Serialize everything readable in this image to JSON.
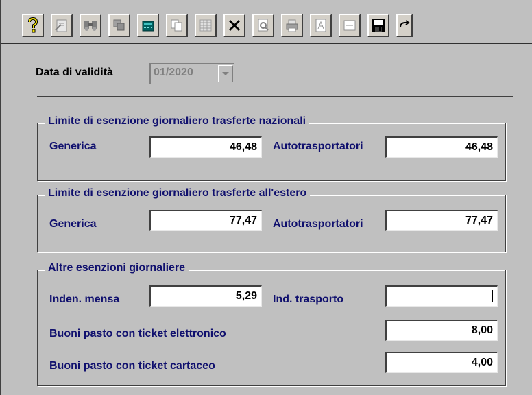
{
  "toolbar": {
    "buttons": [
      {
        "name": "help",
        "icon": "question-mark-icon"
      },
      {
        "name": "properties",
        "icon": "properties-icon"
      },
      {
        "name": "find",
        "icon": "binoculars-icon"
      },
      {
        "name": "copy-record",
        "icon": "copy-stack-icon"
      },
      {
        "name": "calculator",
        "icon": "calculator-icon"
      },
      {
        "name": "duplicate",
        "icon": "duplicate-pages-icon"
      },
      {
        "name": "grid",
        "icon": "grid-icon"
      },
      {
        "name": "delete",
        "icon": "close-x-icon"
      },
      {
        "name": "preview",
        "icon": "print-preview-icon"
      },
      {
        "name": "print",
        "icon": "printer-icon"
      },
      {
        "name": "pdf",
        "icon": "pdf-document-icon"
      },
      {
        "name": "form",
        "icon": "form-icon"
      },
      {
        "name": "save",
        "icon": "floppy-disk-icon"
      },
      {
        "name": "redo",
        "icon": "redo-arrow-icon"
      }
    ]
  },
  "validity": {
    "label": "Data di validità",
    "value": "01/2020"
  },
  "national": {
    "title": "Limite di esenzione giornaliero trasferte nazionali",
    "generic_label": "Generica",
    "generic_value": "46,48",
    "truck_label": "Autotrasportatori",
    "truck_value": "46,48"
  },
  "abroad": {
    "title": "Limite di esenzione giornaliero trasferte all'estero",
    "generic_label": "Generica",
    "generic_value": "77,47",
    "truck_label": "Autotrasportatori",
    "truck_value": "77,47"
  },
  "other": {
    "title": "Altre esenzioni giornaliere",
    "mensa_label": "Inden. mensa",
    "mensa_value": "5,29",
    "trasporto_label": "Ind. trasporto",
    "trasporto_value": "",
    "ticket_elettronico_label": "Buoni pasto con ticket elettronico",
    "ticket_elettronico_value": "8,00",
    "ticket_cartaceo_label": "Buoni pasto con ticket cartaceo",
    "ticket_cartaceo_value": "4,00"
  },
  "colors": {
    "window_bg": "#c0c0c0",
    "label_blue": "#10106e",
    "field_bg": "#ffffff"
  }
}
